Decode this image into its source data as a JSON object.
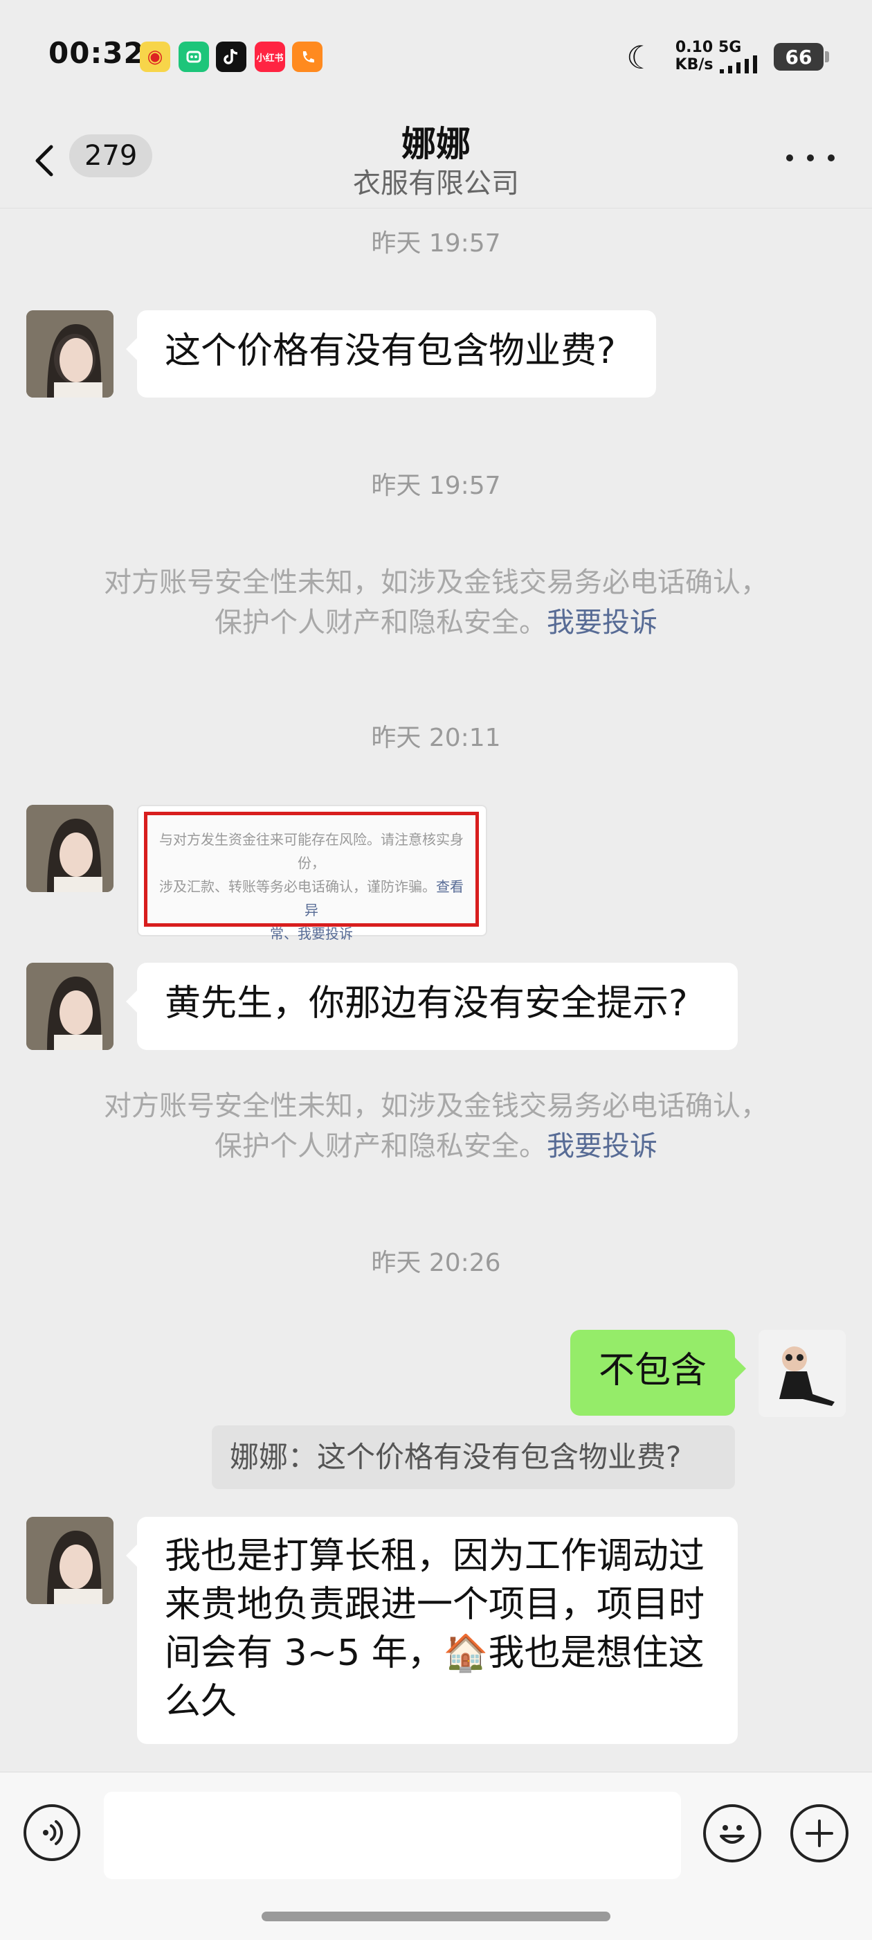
{
  "status_bar": {
    "time": "00:32",
    "xhs_label": "小红书",
    "net_speed_value": "0.10",
    "net_speed_unit": "KB/s",
    "network": "5G",
    "battery": "66"
  },
  "header": {
    "unread_count": "279",
    "name": "娜娜",
    "subtitle": "衣服有限公司"
  },
  "messages": {
    "t1": "昨天 19:57",
    "m1": "这个价格有没有包含物业费?",
    "t2": "昨天 19:57",
    "warn1_line1": "对方账号安全性未知，如涉及金钱交易务必电话确认，",
    "warn1_line2": "保护个人财产和隐私安全。",
    "warn1_link": "我要投诉",
    "t3": "昨天 20:11",
    "img_text_line1": "与对方发生资金往来可能存在风险。请注意核实身份，",
    "img_text_line2a": "涉及汇款、转账等务必电话确认，谨防诈骗。",
    "img_text_line2b": "查看异",
    "img_text_line3": "常、我要投诉",
    "m2": "黄先生，你那边有没有安全提示?",
    "warn2_line1": "对方账号安全性未知，如涉及金钱交易务必电话确认，",
    "warn2_line2": "保护个人财产和隐私安全。",
    "warn2_link": "我要投诉",
    "t4": "昨天 20:26",
    "m3": "不包含",
    "quote": "娜娜：这个价格有没有包含物业费?",
    "m4": "我也是打算长租，因为工作调动过来贵地负责跟进一个项目，项目时间会有 3~5 年，🏠我也是想住这么久"
  },
  "icons": {
    "back": "back-chevron-icon",
    "more": "more-dots-icon",
    "voice": "voice-icon",
    "emoji": "emoji-icon",
    "plus": "plus-icon"
  },
  "colors": {
    "chat_bg": "#ededed",
    "bubble_incoming": "#ffffff",
    "bubble_outgoing": "#95ec69",
    "link": "#576b95",
    "warning_border": "#d81e1e"
  }
}
